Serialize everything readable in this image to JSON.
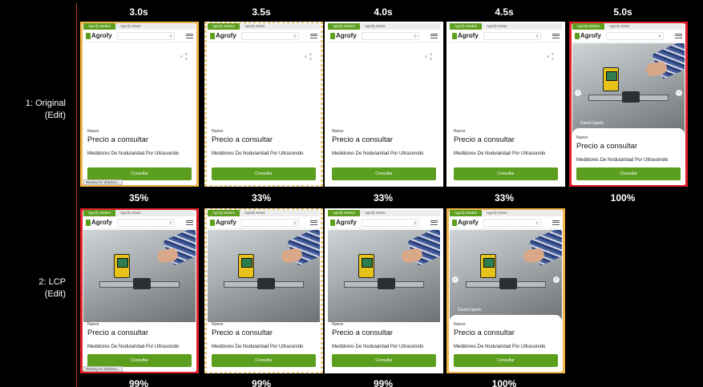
{
  "timeline": {
    "times": [
      "3.0s",
      "3.5s",
      "4.0s",
      "4.5s",
      "5.0s"
    ],
    "rows": [
      {
        "label_line1": "1: Original",
        "label_line2": "(Edit)",
        "frames": [
          {
            "state": "blank",
            "border": "orange",
            "percent": "35%",
            "waiting": "Waiting for d0rphce..."
          },
          {
            "state": "blank",
            "border": "dotted",
            "percent": "33%",
            "waiting": ""
          },
          {
            "state": "blank",
            "border": "none",
            "percent": "33%",
            "waiting": ""
          },
          {
            "state": "blank",
            "border": "none",
            "percent": "33%",
            "waiting": ""
          },
          {
            "state": "carousel",
            "border": "red",
            "percent": "100%",
            "waiting": ""
          }
        ]
      },
      {
        "label_line1": "2: LCP",
        "label_line2": "(Edit)",
        "frames": [
          {
            "state": "photo",
            "border": "red",
            "percent": "99%",
            "waiting": "Waiting for d0rphce..."
          },
          {
            "state": "photo",
            "border": "dotted",
            "percent": "99%",
            "waiting": ""
          },
          {
            "state": "photo",
            "border": "none",
            "percent": "99%",
            "waiting": ""
          },
          {
            "state": "carousel",
            "border": "orange",
            "percent": "100%",
            "waiting": ""
          }
        ]
      }
    ]
  },
  "page": {
    "tab_market": "Agrofy Market",
    "tab_news": "Agrofy News",
    "logo": "Agrofy",
    "nuevo": "Nuevo",
    "price": "Precio a consultar",
    "product_title": "Medidores De Nodularidad Por Ultrasonido",
    "consult_button": "Consultar",
    "seller_name": "David Ugarte"
  },
  "colors": {
    "brand_green": "#5c9e1e",
    "highlight_red": "#e0202a",
    "highlight_orange": "#f4b54a",
    "divider": "#c0392b"
  },
  "icons": [
    "search-icon",
    "hamburger-menu-icon",
    "share-icon",
    "chevron-left-icon",
    "chevron-right-icon"
  ]
}
